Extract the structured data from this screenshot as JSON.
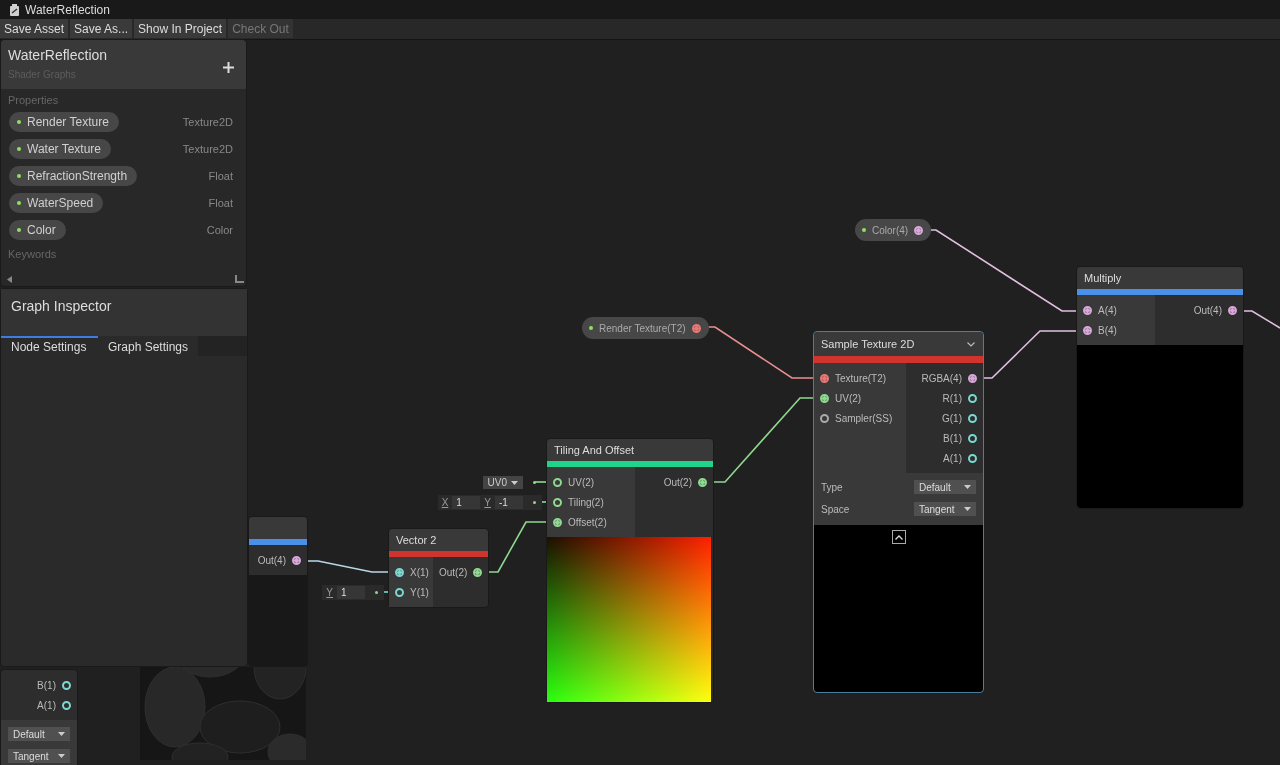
{
  "window": {
    "title": "WaterReflection"
  },
  "toolbar": [
    {
      "label": "Save Asset",
      "disabled": false
    },
    {
      "label": "Save As...",
      "disabled": false
    },
    {
      "label": "Show In Project",
      "disabled": false
    },
    {
      "label": "Check Out",
      "disabled": true
    }
  ],
  "blackboard": {
    "title": "WaterReflection",
    "subtitle": "Shader Graphs",
    "properties_label": "Properties",
    "properties": [
      {
        "name": "Render Texture",
        "type": "Texture2D"
      },
      {
        "name": "Water Texture",
        "type": "Texture2D"
      },
      {
        "name": "RefractionStrength",
        "type": "Float"
      },
      {
        "name": "WaterSpeed",
        "type": "Float"
      },
      {
        "name": "Color",
        "type": "Color"
      }
    ],
    "keywords_label": "Keywords"
  },
  "inspector": {
    "title": "Graph Inspector",
    "tabs": [
      {
        "label": "Node Settings",
        "selected": true
      },
      {
        "label": "Graph Settings",
        "selected": false
      }
    ]
  },
  "property_nodes": [
    {
      "label": "Color(4)",
      "color": "#d8a8d8"
    },
    {
      "label": "Render Texture(T2)",
      "color": "#e87878"
    }
  ],
  "nodes": [
    {
      "selected": false,
      "expanded": false,
      "outputs": [
        {
          "label": "B(1)",
          "color": "#7ad8d0",
          "connected": false
        },
        {
          "label": "A(1)",
          "color": "#7ad8d0",
          "connected": false
        }
      ],
      "controls": [
        {
          "value": "Default"
        },
        {
          "value": "Tangent"
        }
      ]
    },
    {
      "selected": false,
      "expanded": false,
      "color": "#4a8fe8",
      "outputs": [
        {
          "label": "Out(4)",
          "color": "#d8a8d8",
          "connected": true
        }
      ],
      "preview": {
        "kind": "picture"
      }
    },
    {
      "selected": false,
      "expanded": false,
      "title": "Vector 2",
      "color": "#d0342c",
      "inputs": [
        {
          "label": "X(1)",
          "color": "#7ad8d0",
          "connected": true
        },
        {
          "label": "Y(1)",
          "color": "#7ad8d0",
          "connected": false,
          "default": {
            "kind": "vector",
            "fields": [
              {
                "axis": "Y",
                "value": "1"
              }
            ]
          }
        }
      ],
      "outputs": [
        {
          "label": "Out(2)",
          "color": "#8fd88f",
          "connected": true
        }
      ]
    },
    {
      "selected": false,
      "expanded": false,
      "title": "Tiling And Offset",
      "color": "#1fd48a",
      "inputs": [
        {
          "label": "UV(2)",
          "color": "#8fd88f",
          "connected": false,
          "default": {
            "kind": "dropdown",
            "value": "UV0"
          }
        },
        {
          "label": "Tiling(2)",
          "color": "#8fd88f",
          "connected": false,
          "default": {
            "kind": "vector",
            "fields": [
              {
                "axis": "X",
                "value": "1"
              },
              {
                "axis": "Y",
                "value": "-1"
              }
            ]
          }
        },
        {
          "label": "Offset(2)",
          "color": "#8fd88f",
          "connected": true
        }
      ],
      "outputs": [
        {
          "label": "Out(2)",
          "color": "#8fd88f",
          "connected": true
        }
      ],
      "preview": {
        "kind": "picture"
      }
    },
    {
      "selected": true,
      "expanded": true,
      "title": "Sample Texture 2D",
      "color": "#d0342c",
      "inputs": [
        {
          "label": "Texture(T2)",
          "color": "#e87878",
          "connected": true
        },
        {
          "label": "UV(2)",
          "color": "#8fd88f",
          "connected": true
        },
        {
          "label": "Sampler(SS)",
          "color": "#aaaaaa",
          "connected": false
        }
      ],
      "outputs": [
        {
          "label": "RGBA(4)",
          "color": "#d8a8d8",
          "connected": true
        },
        {
          "label": "R(1)",
          "color": "#7ad8d0",
          "connected": false
        },
        {
          "label": "G(1)",
          "color": "#7ad8d0",
          "connected": false
        },
        {
          "label": "B(1)",
          "color": "#7ad8d0",
          "connected": false
        },
        {
          "label": "A(1)",
          "color": "#7ad8d0",
          "connected": false
        }
      ],
      "controls": [
        {
          "label": "Type",
          "value": "Default"
        },
        {
          "label": "Space",
          "value": "Tangent"
        }
      ],
      "preview": {
        "kind": "blank"
      }
    },
    {
      "selected": false,
      "expanded": false,
      "title": "Multiply",
      "color": "#4a8fe8",
      "inputs": [
        {
          "label": "A(4)",
          "color": "#d8a8d8",
          "connected": true
        },
        {
          "label": "B(4)",
          "color": "#d8a8d8",
          "connected": true
        }
      ],
      "outputs": [
        {
          "label": "Out(4)",
          "color": "#d8a8d8",
          "connected": true
        }
      ],
      "preview": {
        "kind": "blank"
      }
    }
  ]
}
